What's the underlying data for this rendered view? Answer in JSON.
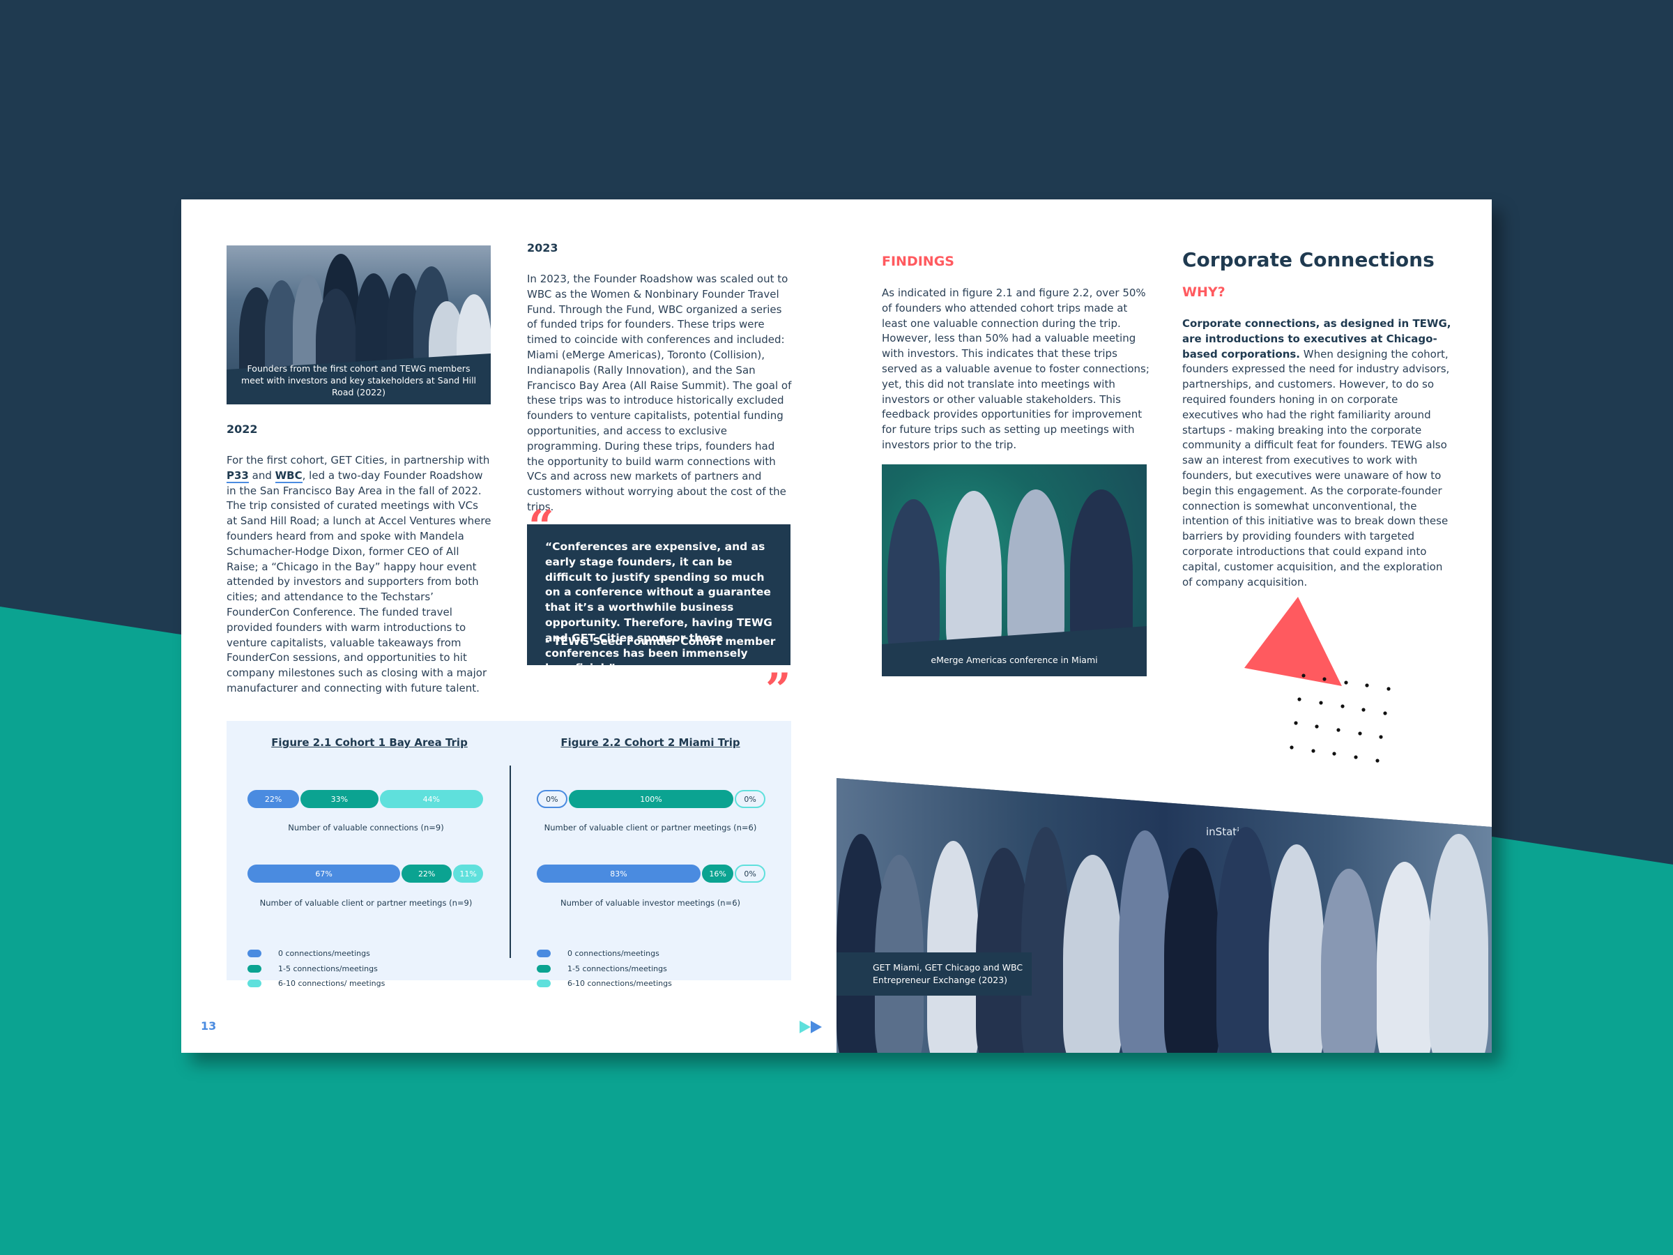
{
  "colors": {
    "navy": "#1f3a50",
    "teal": "#0ba391",
    "coral": "#ff5a5f",
    "blue": "#4a8be0",
    "aqua": "#5fe0dc",
    "panel": "#ebf3fd"
  },
  "left_page": {
    "photo1": {
      "caption": "Founders from the first cohort and TEWG members meet with investors and key stakeholders at Sand Hill Road (2022)"
    },
    "section_2022": {
      "heading": "2022",
      "text_before_p33": "For the first cohort, GET Cities, in partnership with ",
      "link_p33": "P33",
      "text_and": " and ",
      "link_wbc": "WBC",
      "text_after": ", led a two-day Founder Roadshow in the San Francisco Bay Area in the fall of 2022. The trip consisted of curated meetings with VCs at Sand Hill Road; a lunch at Accel Ventures where founders heard from and spoke with Mandela Schumacher-Hodge Dixon, former CEO of All Raise; a “Chicago in the Bay” happy hour event attended by investors and supporters from both cities; and attendance to the Techstars’ FounderCon Conference. The funded travel provided founders with warm introductions to venture capitalists, valuable takeaways from FounderCon sessions, and opportunities to hit company milestones such as closing with a major manufacturer and connecting with future talent."
    },
    "section_2023": {
      "heading": "2023",
      "text": "In 2023, the Founder Roadshow was scaled out to WBC as the Women & Nonbinary Founder Travel Fund. Through the Fund, WBC organized a series of funded trips for founders. These trips were timed to coincide with conferences and included: Miami (eMerge Americas), Toronto (Collision), Indianapolis (Rally Innovation), and the San Francisco Bay Area (All Raise Summit). The goal of these trips was to introduce historically excluded founders to venture capitalists, potential funding opportunities, and access to exclusive programming. During these trips, founders had the opportunity to build warm connections with VCs and across new markets of partners and customers without worrying about the cost of the trips."
    },
    "quote": {
      "open_mark": "“",
      "close_mark": "”",
      "text": "“Conferences are expensive, and as early stage founders, it can be difficult to justify spending so much on a conference without a guarantee that it’s a worthwhile business opportunity. Therefore, having TEWG and GET Cities sponsor these conferences has been immensely beneficial.”",
      "attribution": "- TEWG Seed Founder Cohort member"
    },
    "page_number": "13",
    "next_icon": "fast-forward-icon"
  },
  "chart_data": [
    {
      "type": "bar",
      "orientation": "horizontal-stacked-100",
      "title": "Figure 2.1 Cohort 1 Bay Area Trip",
      "legend": [
        "0 connections/meetings",
        "1-5 connections/meetings",
        "6-10 connections/ meetings"
      ],
      "legend_colors": [
        "#4a8be0",
        "#0ba391",
        "#5fe0dc"
      ],
      "legend_position": "bottom-left",
      "rows": [
        {
          "label": "Number of valuable connections (n=9)",
          "values": [
            22,
            33,
            44
          ],
          "labels": [
            "22%",
            "33%",
            "44%"
          ]
        },
        {
          "label": "Number of valuable client or partner meetings (n=9)",
          "values": [
            67,
            22,
            11
          ],
          "labels": [
            "67%",
            "22%",
            "11%"
          ]
        }
      ]
    },
    {
      "type": "bar",
      "orientation": "horizontal-stacked-100",
      "title": "Figure 2.2 Cohort 2 Miami Trip",
      "legend": [
        "0 connections/meetings",
        "1-5 connections/meetings",
        "6-10 connections/meetings"
      ],
      "legend_colors": [
        "#4a8be0",
        "#0ba391",
        "#5fe0dc"
      ],
      "legend_position": "bottom-left",
      "rows": [
        {
          "label": "Number of valuable client or partner meetings (n=6)",
          "values": [
            0,
            100,
            0
          ],
          "labels": [
            "0%",
            "100%",
            "0%"
          ]
        },
        {
          "label": "Number of valuable investor meetings (n=6)",
          "values": [
            83,
            16,
            0
          ],
          "labels": [
            "83%",
            "16%",
            "0%"
          ]
        }
      ]
    }
  ],
  "right_page": {
    "findings": {
      "heading": "FINDINGS",
      "text": "As indicated in figure 2.1 and figure 2.2, over 50% of founders who attended cohort trips made at least one valuable connection during the trip. However, less than 50% had a valuable meeting with investors. This indicates that these trips served as a valuable avenue to foster connections; yet, this did not translate into meetings with investors or other valuable stakeholders. This feedback provides opportunities for improvement for future trips such as setting up meetings with investors prior to the trip."
    },
    "photo2": {
      "caption": "eMerge Americas conference in Miami"
    },
    "corporate": {
      "heading": "Corporate Connections",
      "subheading": "WHY?",
      "bold_lead": "Corporate connections, as designed in TEWG, are introductions to executives at Chicago-based corporations.",
      "text": " When designing the cohort, founders expressed the need for industry advisors, partnerships, and customers. However, to do so required founders honing in on corporate executives who had the right familiarity around startups - making breaking into the corporate community a difficult feat for founders. TEWG also saw an interest from executives to work with founders, but executives were unaware of how to begin this engagement. As the corporate-founder connection is somewhat unconventional, the intention of this initiative was to break down these barriers by providing founders with targeted corporate introductions that could expand into capital, customer acquisition, and the exploration of company acquisition."
    },
    "photo3": {
      "caption_line1": "GET Miami, GET Chicago and WBC",
      "caption_line2": "Entrepreneur Exchange (2023)",
      "sign_text": "inStatic"
    }
  }
}
